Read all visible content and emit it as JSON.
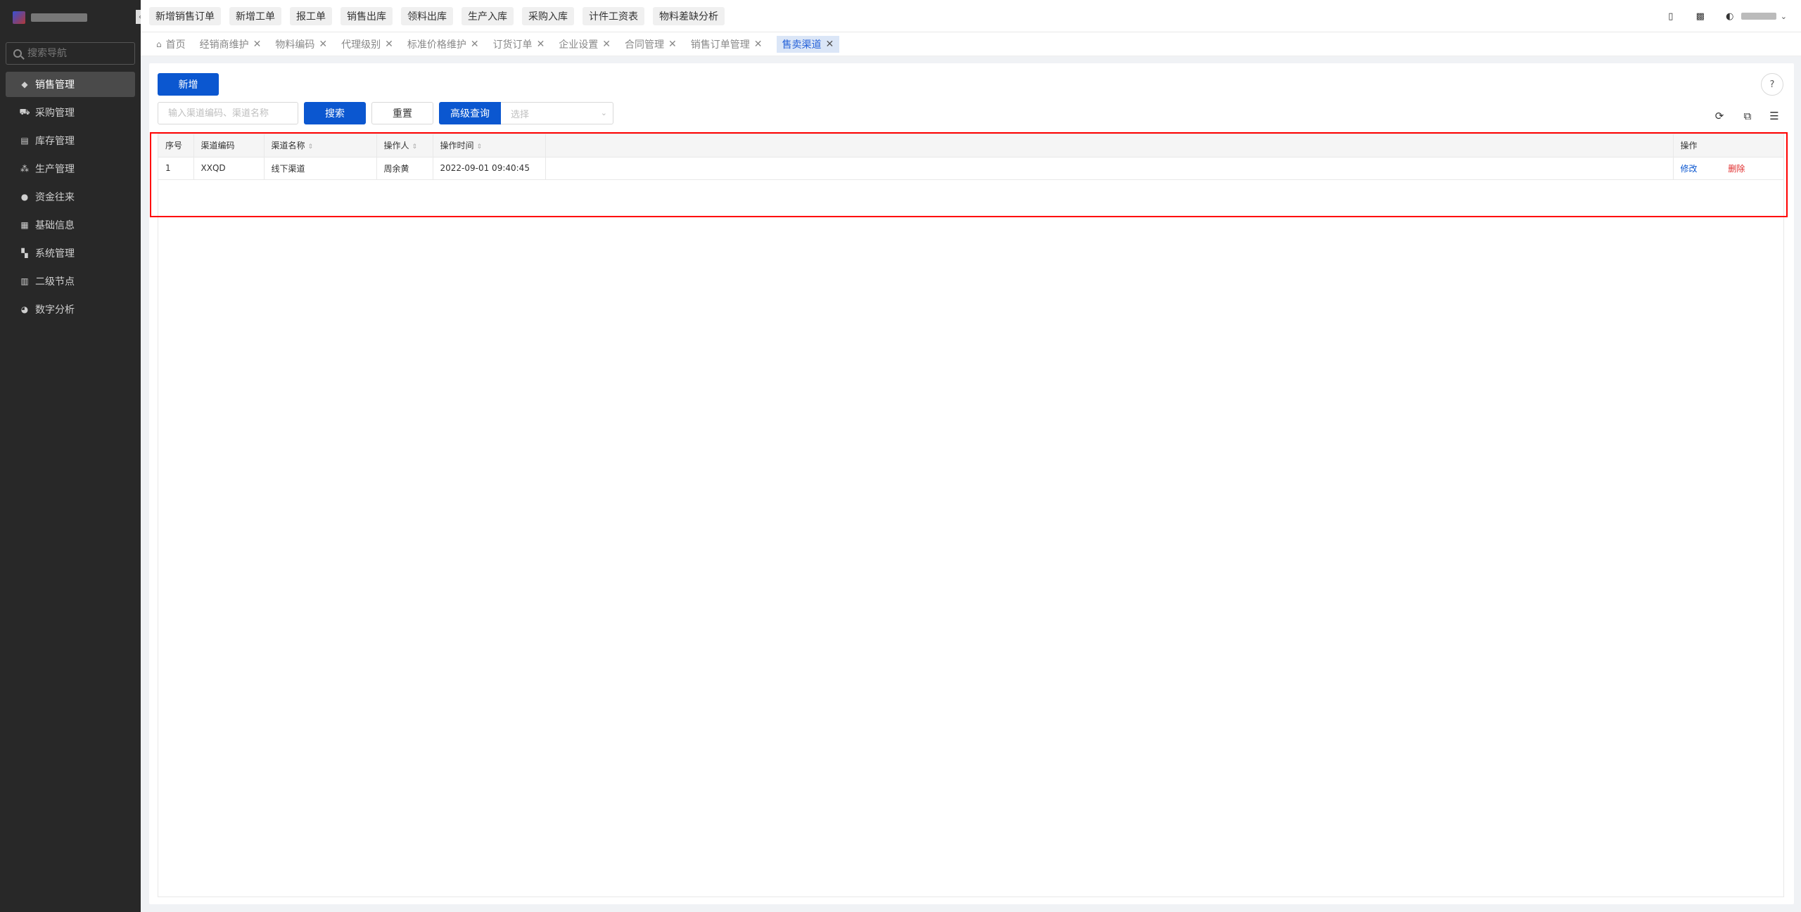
{
  "sidebar": {
    "search_placeholder": "搜索导航",
    "collapse_glyph": "‹",
    "items": [
      {
        "label": "销售管理",
        "icon": "tag-icon",
        "glyph": "◆"
      },
      {
        "label": "采购管理",
        "icon": "cart-icon",
        "glyph": "⛟"
      },
      {
        "label": "库存管理",
        "icon": "box-icon",
        "glyph": "▤"
      },
      {
        "label": "生产管理",
        "icon": "production-icon",
        "glyph": "⁂"
      },
      {
        "label": "资金往来",
        "icon": "money-icon",
        "glyph": "●"
      },
      {
        "label": "基础信息",
        "icon": "grid-icon",
        "glyph": "▦"
      },
      {
        "label": "系统管理",
        "icon": "apps-icon",
        "glyph": "▚"
      },
      {
        "label": "二级节点",
        "icon": "document-icon",
        "glyph": "▥"
      },
      {
        "label": "数字分析",
        "icon": "pie-chart-icon",
        "glyph": "◕"
      }
    ]
  },
  "topbar": {
    "quick_actions": [
      "新增销售订单",
      "新增工单",
      "报工单",
      "销售出库",
      "领料出库",
      "生产入库",
      "采购入库",
      "计件工资表",
      "物料差缺分析"
    ],
    "icons": {
      "mobile": {
        "name": "mobile-icon",
        "glyph": "▯"
      },
      "image": {
        "name": "image-icon",
        "glyph": "▩"
      },
      "avatar": {
        "name": "avatar-icon",
        "glyph": "◐"
      },
      "chevron": {
        "name": "chevron-down-icon",
        "glyph": "⌄"
      }
    }
  },
  "tabs": {
    "home": "首页",
    "home_glyph": "⌂",
    "close_glyph": "✕",
    "items": [
      "经销商维护",
      "物料编码",
      "代理级别",
      "标准价格维护",
      "订货订单",
      "企业设置",
      "合同管理",
      "销售订单管理"
    ],
    "active": "售卖渠道"
  },
  "toolbar": {
    "add_label": "新增",
    "search_placeholder": "输入渠道编码、渠道名称",
    "search_label": "搜索",
    "reset_label": "重置",
    "advanced_label": "高级查询",
    "select_placeholder": "选择",
    "select_arrow": "⌄",
    "help_glyph": "?",
    "refresh_glyph": "⟳",
    "fullscreen_glyph": "⧉",
    "settings_glyph": "☰"
  },
  "table": {
    "sort_glyph": "⇕",
    "columns": [
      "序号",
      "渠道编码",
      "渠道名称",
      "操作人",
      "操作时间",
      "",
      "操作"
    ],
    "rows": [
      {
        "index": "1",
        "code": "XXQD",
        "name": "线下渠道",
        "operator": "周余黄",
        "time": "2022-09-01 09:40:45"
      }
    ],
    "edit_label": "修改",
    "delete_label": "删除"
  },
  "colors": {
    "primary": "#0b57d0",
    "danger": "#e02d2d",
    "sidebar_bg": "#282828",
    "highlight": "#ff0000"
  }
}
